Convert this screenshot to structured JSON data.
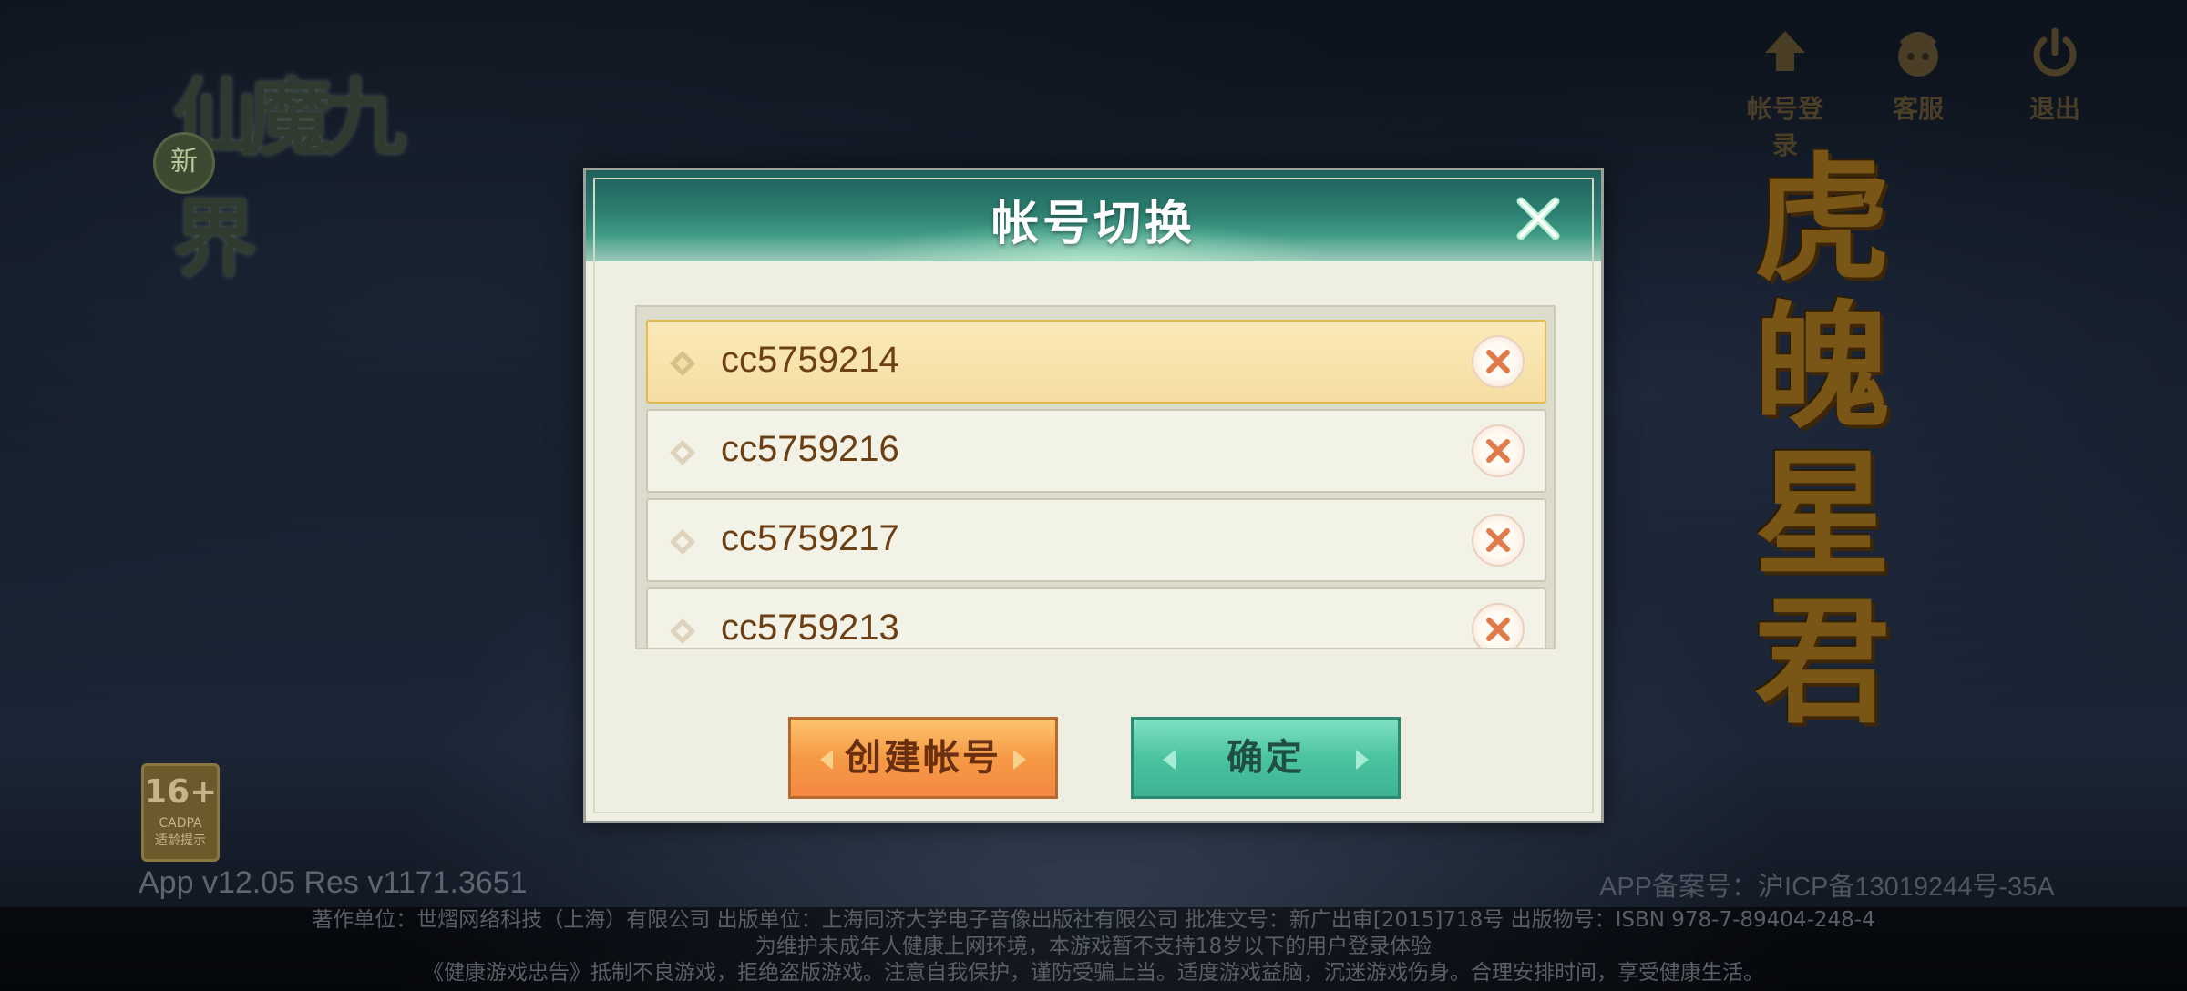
{
  "background": {
    "logo_text": "仙魔九界",
    "logo_badge": "新",
    "vertical_title": [
      "虎",
      "魄",
      "星",
      "君"
    ],
    "age_rating": {
      "value": "16+",
      "org": "CADPA",
      "caption": "适龄提示"
    },
    "version": "App v12.05 Res v1171.3651",
    "icp": "APP备案号：沪ICP备13019244号-35A"
  },
  "top_buttons": [
    {
      "label": "帐号登录",
      "icon": "account-login-icon"
    },
    {
      "label": "客服",
      "icon": "customer-service-icon"
    },
    {
      "label": "退出",
      "icon": "power-icon"
    }
  ],
  "dialog": {
    "title": "帐号切换",
    "accounts": [
      {
        "name": "cc5759214",
        "selected": true
      },
      {
        "name": "cc5759216",
        "selected": false
      },
      {
        "name": "cc5759217",
        "selected": false
      },
      {
        "name": "cc5759213",
        "selected": false
      }
    ],
    "create_label": "创建帐号",
    "confirm_label": "确定"
  },
  "footer": {
    "line1": "著作单位：世熠网络科技（上海）有限公司 出版单位：上海同济大学电子音像出版社有限公司 批准文号：新广出审[2015]718号 出版物号：ISBN 978-7-89404-248-4",
    "line2": "为维护未成年人健康上网环境，本游戏暂不支持18岁以下的用户登录体验",
    "line3": "《健康游戏忠告》抵制不良游戏，拒绝盗版游戏。注意自我保护，谨防受骗上当。适度游戏益脑，沉迷游戏伤身。合理安排时间，享受健康生活。"
  },
  "colors": {
    "dialog_header": "#2c7d70",
    "selected_row": "#f5dea4",
    "create_button": "#f59a45",
    "confirm_button": "#4bc3a0"
  }
}
